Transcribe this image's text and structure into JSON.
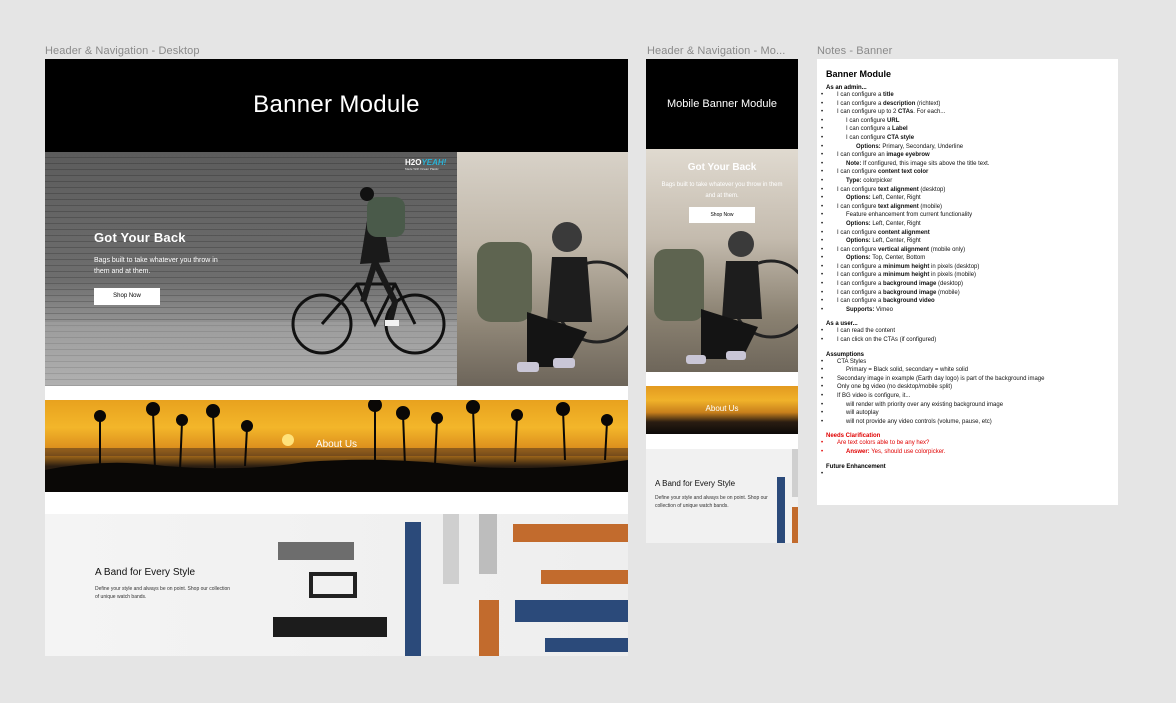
{
  "frames": {
    "desktop_label": "Header & Navigation - Desktop",
    "mobile_label": "Header  & Navigation - Mo...",
    "notes_label": "Notes - Banner"
  },
  "desktop": {
    "header_title": "Banner Module",
    "hero": {
      "logo_main": "H2O",
      "logo_accent": "YEAH!",
      "logo_sub": "Made With Ocean Plastic",
      "title": "Got Your Back",
      "description": "Bags built to take whatever you throw in them and at them.",
      "cta": "Shop Now"
    },
    "banner_label": "About Us",
    "band": {
      "title": "A Band for Every Style",
      "description": "Define your style and always be on point. Shop our collection of unique watch bands."
    }
  },
  "mobile": {
    "header_title": "Mobile Banner Module",
    "hero": {
      "title": "Got Your Back",
      "description": "Bags built to take whatever you throw in them and at them.",
      "cta": "Shop Now"
    },
    "banner_label": "About Us",
    "band": {
      "title": "A Band for Every Style",
      "description": "Define your style and always be on point. Shop our collection of unique watch bands."
    }
  },
  "notes": {
    "title": "Banner Module",
    "admin_heading": "As an admin...",
    "admin_items": [
      {
        "level": 1,
        "pre": "I can configure a ",
        "bold": "title",
        "post": ""
      },
      {
        "level": 1,
        "pre": "I can configure a ",
        "bold": "description",
        "post": " (richtext)"
      },
      {
        "level": 1,
        "pre": "I can configure up to 2 ",
        "bold": "CTAs",
        "post": ". For each..."
      },
      {
        "level": 2,
        "pre": "I can configure ",
        "bold": "URL",
        "post": ""
      },
      {
        "level": 2,
        "pre": "I can configure a ",
        "bold": "Label",
        "post": ""
      },
      {
        "level": 2,
        "pre": "I can configure ",
        "bold": "CTA style",
        "post": ""
      },
      {
        "level": 3,
        "pre": "",
        "bold": "Options:",
        "post": " Primary, Secondary, Underline"
      },
      {
        "level": 1,
        "pre": "I can configure an ",
        "bold": "image eyebrow",
        "post": ""
      },
      {
        "level": 2,
        "pre": "",
        "bold": "Note:",
        "post": " If configured, this image sits above the title text."
      },
      {
        "level": 1,
        "pre": "I can configure ",
        "bold": "content text color",
        "post": ""
      },
      {
        "level": 2,
        "pre": "",
        "bold": "Type:",
        "post": " colorpicker"
      },
      {
        "level": 1,
        "pre": "I can configure ",
        "bold": "text alignment",
        "post": " (desktop)"
      },
      {
        "level": 2,
        "pre": "",
        "bold": "Options:",
        "post": " Left, Center, Right"
      },
      {
        "level": 1,
        "pre": "I can configure ",
        "bold": "text alignment",
        "post": " (mobile)"
      },
      {
        "level": 2,
        "pre": "Feature enhancement from current functionality",
        "bold": "",
        "post": ""
      },
      {
        "level": 2,
        "pre": "",
        "bold": "Options:",
        "post": " Left, Center, Right"
      },
      {
        "level": 1,
        "pre": "I can configure ",
        "bold": "content alignment",
        "post": ""
      },
      {
        "level": 2,
        "pre": "",
        "bold": "Options:",
        "post": " Left, Center, Right"
      },
      {
        "level": 1,
        "pre": "I can configure ",
        "bold": "vertical alignment",
        "post": " (mobile only)"
      },
      {
        "level": 2,
        "pre": "",
        "bold": "Options:",
        "post": " Top, Center, Bottom"
      },
      {
        "level": 1,
        "pre": "I can configure a ",
        "bold": "minimum height",
        "post": " in pixels (desktop)"
      },
      {
        "level": 1,
        "pre": "I can configure a ",
        "bold": "minimum height",
        "post": " in pixels (mobile)"
      },
      {
        "level": 1,
        "pre": "I can configure a ",
        "bold": "background image",
        "post": " (desktop)"
      },
      {
        "level": 1,
        "pre": "I can configure a ",
        "bold": "background image",
        "post": " (mobile)"
      },
      {
        "level": 1,
        "pre": "I can configure a ",
        "bold": "background video",
        "post": ""
      },
      {
        "level": 2,
        "pre": "",
        "bold": "Supports:",
        "post": " Vimeo"
      }
    ],
    "user_heading": "As a user...",
    "user_items": [
      {
        "level": 1,
        "pre": "I can read the content",
        "bold": "",
        "post": ""
      },
      {
        "level": 1,
        "pre": "I can click on the CTAs (if configured)",
        "bold": "",
        "post": ""
      }
    ],
    "assumptions_heading": "Assumptions",
    "assumptions_items": [
      {
        "level": 1,
        "pre": "CTA Styles",
        "bold": "",
        "post": ""
      },
      {
        "level": 2,
        "pre": "Primary = Black solid, secondary = white solid",
        "bold": "",
        "post": ""
      },
      {
        "level": 1,
        "pre": "Secondary image in example (Earth day logo) is part of the background image",
        "bold": "",
        "post": ""
      },
      {
        "level": 1,
        "pre": "Only one bg video (no desktop/mobile split)",
        "bold": "",
        "post": ""
      },
      {
        "level": 1,
        "pre": "If BG video is configure, it...",
        "bold": "",
        "post": ""
      },
      {
        "level": 2,
        "pre": "will render with priority over any existing background image",
        "bold": "",
        "post": ""
      },
      {
        "level": 2,
        "pre": "will autoplay",
        "bold": "",
        "post": ""
      },
      {
        "level": 2,
        "pre": "will not provide any video controls (volume, pause, etc)",
        "bold": "",
        "post": ""
      }
    ],
    "clarification_heading": "Needs Clarification",
    "clarification_items": [
      {
        "level": 1,
        "pre": "Are text colors able to be any hex?",
        "bold": "",
        "post": ""
      },
      {
        "level": 2,
        "pre": "",
        "bold": "Answer:",
        "post": " Yes, should use colorpicker."
      }
    ],
    "future_heading": "Future Enhancement",
    "future_items": [
      {
        "level": 2,
        "pre": "",
        "bold": "",
        "post": ""
      }
    ]
  }
}
